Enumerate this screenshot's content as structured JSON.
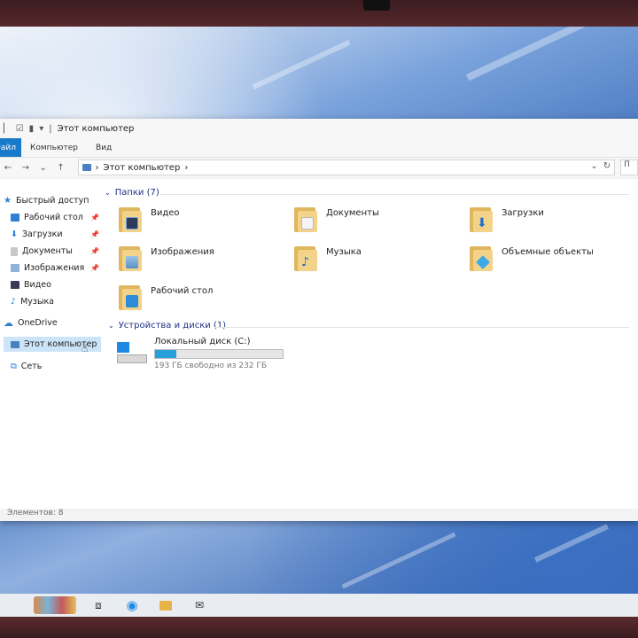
{
  "window": {
    "title": "Этот компьютер",
    "ribbon_tabs": [
      "Файл",
      "Компьютер",
      "Вид"
    ],
    "address": {
      "path": "Этот компьютер",
      "separator": "›",
      "search_placeholder": "П"
    },
    "quick_access_icons": [
      "properties-icon",
      "checkbox-icon",
      "folder-icon",
      "dropdown-icon"
    ]
  },
  "sidebar": {
    "items": [
      {
        "label": "Быстрый доступ",
        "icon": "star-icon",
        "pinned": false
      },
      {
        "label": "Рабочий стол",
        "icon": "desktop-icon",
        "pinned": true
      },
      {
        "label": "Загрузки",
        "icon": "download-icon",
        "pinned": true
      },
      {
        "label": "Документы",
        "icon": "documents-icon",
        "pinned": true
      },
      {
        "label": "Изображения",
        "icon": "pictures-icon",
        "pinned": true
      },
      {
        "label": "Видео",
        "icon": "video-icon",
        "pinned": false
      },
      {
        "label": "Музыка",
        "icon": "music-icon",
        "pinned": false
      },
      {
        "label": "OneDrive",
        "icon": "cloud-icon",
        "pinned": false
      },
      {
        "label": "Этот компьютер",
        "icon": "computer-icon",
        "pinned": false,
        "selected": true
      },
      {
        "label": "Сеть",
        "icon": "network-icon",
        "pinned": false
      }
    ]
  },
  "main": {
    "folders_header": "Папки (7)",
    "folders": [
      {
        "label": "Видео",
        "icon": "video-folder-icon"
      },
      {
        "label": "Документы",
        "icon": "documents-folder-icon"
      },
      {
        "label": "Загрузки",
        "icon": "downloads-folder-icon"
      },
      {
        "label": "Изображения",
        "icon": "pictures-folder-icon"
      },
      {
        "label": "Музыка",
        "icon": "music-folder-icon"
      },
      {
        "label": "Объемные объекты",
        "icon": "3d-objects-folder-icon"
      },
      {
        "label": "Рабочий стол",
        "icon": "desktop-folder-icon"
      }
    ],
    "drives_header": "Устройства и диски (1)",
    "drives": [
      {
        "label": "Локальный диск (C:)",
        "free_text": "193 ГБ свободно из 232 ГБ",
        "used_fraction": 0.17
      }
    ]
  },
  "status": {
    "items_text": "Элементов: 8"
  },
  "taskbar": {
    "icons": [
      "start-icon",
      "task-view-icon",
      "edge-icon",
      "file-explorer-icon",
      "mail-icon"
    ]
  },
  "colors": {
    "accent": "#1979ca",
    "progress": "#26a0da",
    "header_text": "#1e3287"
  }
}
